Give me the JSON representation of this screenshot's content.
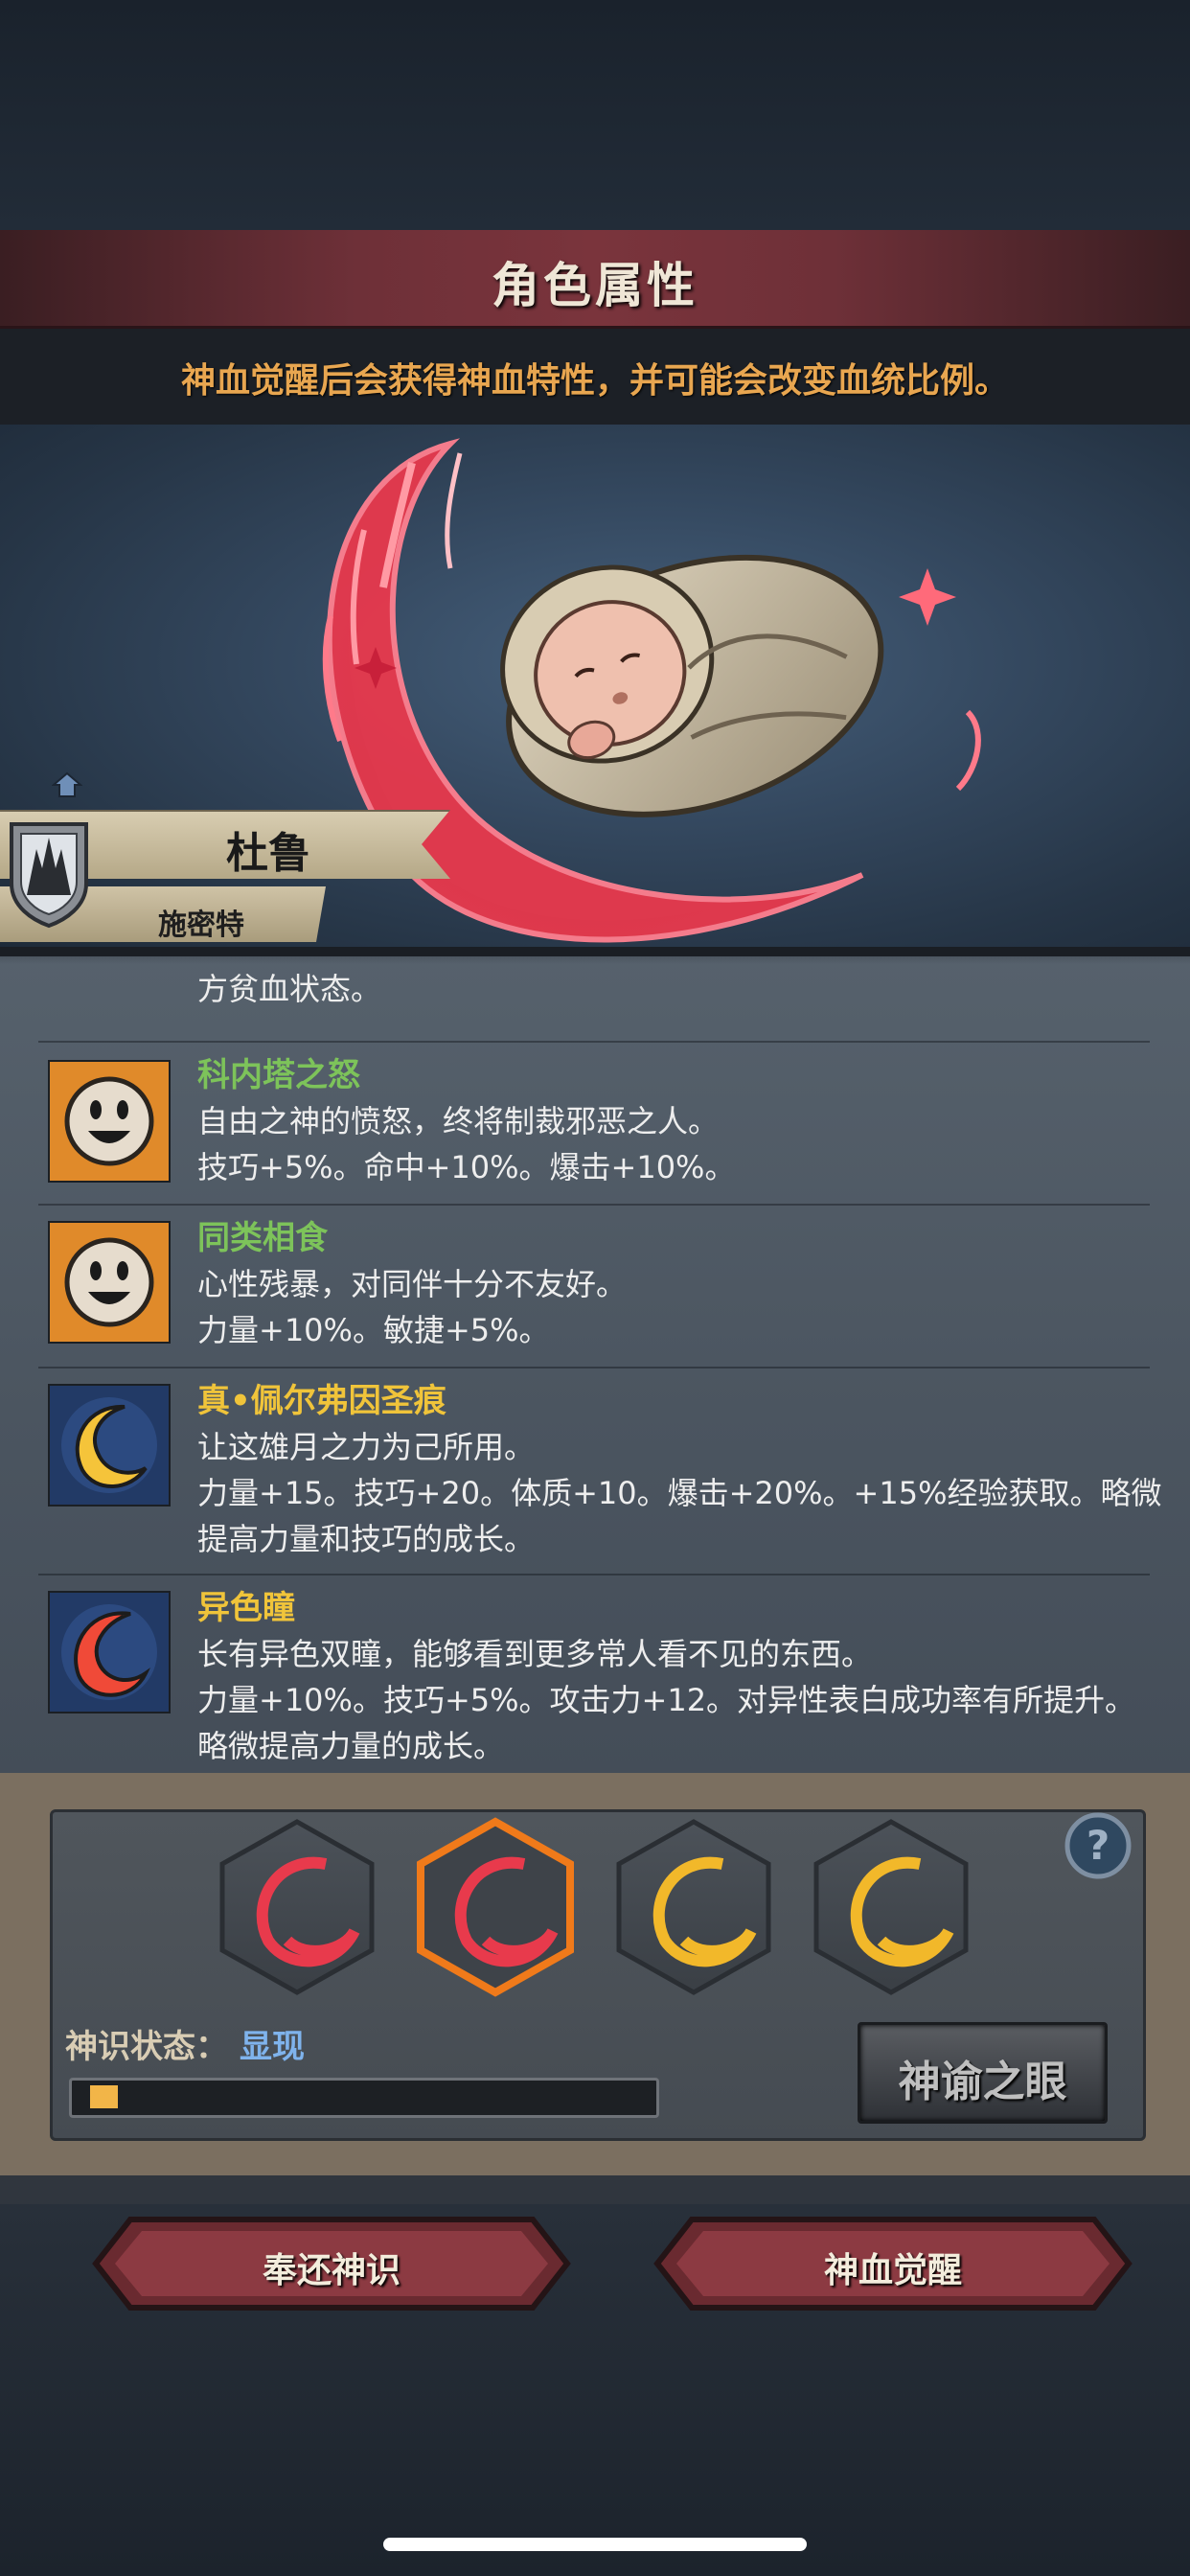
{
  "header": {
    "title": "角色属性",
    "subtitle": "神血觉醒后会获得神血特性，并可能会改变血统比例。"
  },
  "character": {
    "name": "杜鲁",
    "class": "施密特"
  },
  "traits": {
    "partial_text": "方贫血状态。",
    "items": [
      {
        "name": "科内塔之怒",
        "name_color": "#7dc35a",
        "description": "自由之神的愤怒，终将制裁邪恶之人。",
        "effects": "技巧+5%。命中+10%。爆击+10%。",
        "effects2": "",
        "icon": "smiley-face-icon"
      },
      {
        "name": "同类相食",
        "name_color": "#7dc35a",
        "description": "心性残暴，对同伴十分不友好。",
        "effects": "力量+10%。敏捷+5%。",
        "effects2": "",
        "icon": "smiley-face-icon"
      },
      {
        "name": "真•佩尔弗因圣痕",
        "name_color": "#f0c43a",
        "description": "让这雄月之力为己所用。",
        "effects": "力量+15。技巧+20。体质+10。爆击+20%。+15%经验获取。略微",
        "effects2": "提高力量和技巧的成长。",
        "icon": "crescent-moon-icon"
      },
      {
        "name": "异色瞳",
        "name_color": "#f0c43a",
        "description": "长有异色双瞳，能够看到更多常人看不见的东西。",
        "effects": "力量+10%。技巧+5%。攻击力+12。对异性表白成功率有所提升。",
        "effects2": "略微提高力量的成长。",
        "icon": "red-swirl-icon"
      }
    ]
  },
  "divine": {
    "status_label": "神识状态：",
    "status_value": "显现",
    "progress": 0.05,
    "eye_button": "神谕之眼",
    "slots": [
      "red-crescent-icon",
      "red-crescent-icon",
      "gold-crescent-icon",
      "gold-crescent-icon"
    ],
    "selected_slot": 1
  },
  "actions": {
    "return_button": "奉还神识",
    "awaken_button": "神血觉醒"
  },
  "colors": {
    "accent_red": "#7a343c",
    "accent_gold": "#e8a650",
    "status_blue": "#7fb3ec"
  }
}
